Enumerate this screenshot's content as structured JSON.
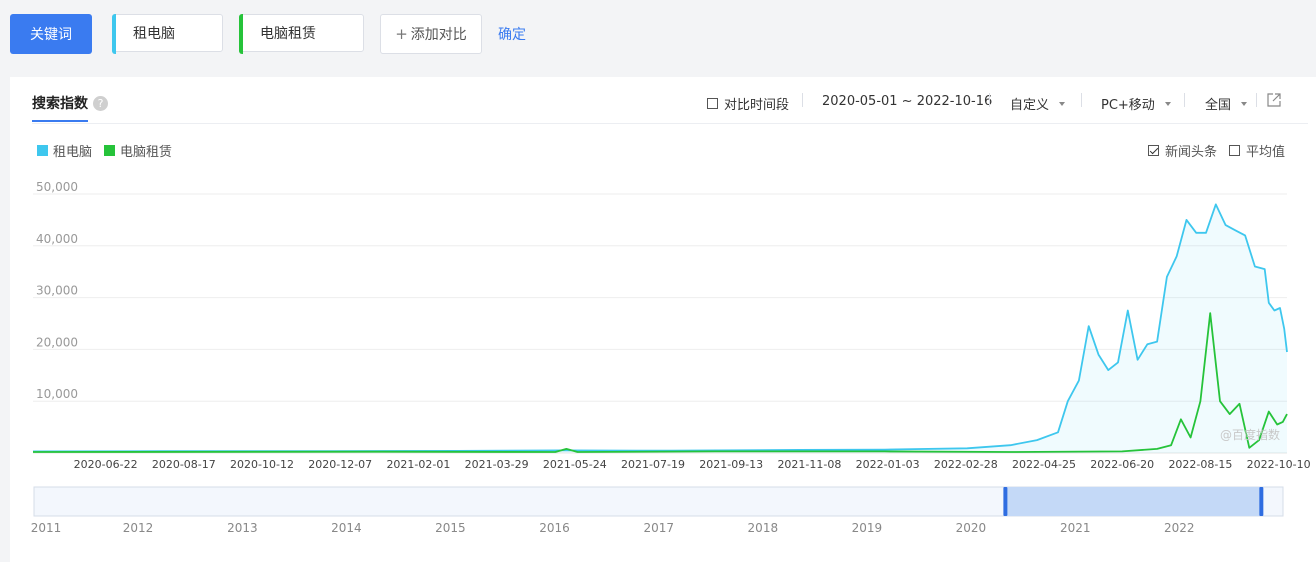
{
  "toolbar": {
    "keyword_button": "关键词",
    "keywords": [
      {
        "label": "租电脑",
        "color": "#3ec7ee"
      },
      {
        "label": "电脑租赁",
        "color": "#26c33a"
      }
    ],
    "add_compare": "添加对比",
    "confirm": "确定"
  },
  "panel": {
    "tab_label": "搜索指数",
    "help_glyph": "?",
    "compare_period": "对比时间段",
    "date_range": "2020-05-01 ~ 2022-10-16",
    "custom": "自定义",
    "device": "PC+移动",
    "region": "全国",
    "news_headlines": "新闻头条",
    "average": "平均值",
    "watermark": "@百度指数"
  },
  "chart_data": {
    "type": "line",
    "title": "",
    "xlabel": "",
    "ylabel": "",
    "ylim": [
      0,
      50000
    ],
    "yticks": [
      "10,000",
      "20,000",
      "30,000",
      "40,000",
      "50,000"
    ],
    "ytick_values": [
      10000,
      20000,
      30000,
      40000,
      50000
    ],
    "x_tick_labels": [
      "2020-06-22",
      "2020-08-17",
      "2020-10-12",
      "2020-12-07",
      "2021-02-01",
      "2021-03-29",
      "2021-05-24",
      "2021-07-19",
      "2021-09-13",
      "2021-11-08",
      "2022-01-03",
      "2022-02-28",
      "2022-04-25",
      "2022-06-20",
      "2022-08-15",
      "2022-10-10"
    ],
    "x_start": "2020-05-01",
    "x_end": "2022-10-16",
    "grid": true,
    "legend": "top-left",
    "series": [
      {
        "name": "租电脑",
        "color": "#3ec7ee",
        "area": true,
        "points": [
          [
            "2020-05-01",
            300
          ],
          [
            "2020-08-01",
            350
          ],
          [
            "2020-12-01",
            350
          ],
          [
            "2021-03-01",
            400
          ],
          [
            "2021-05-15",
            500
          ],
          [
            "2021-08-01",
            450
          ],
          [
            "2021-11-01",
            600
          ],
          [
            "2022-01-01",
            650
          ],
          [
            "2022-03-01",
            900
          ],
          [
            "2022-04-01",
            1500
          ],
          [
            "2022-04-20",
            2500
          ],
          [
            "2022-05-05",
            4000
          ],
          [
            "2022-05-12",
            10000
          ],
          [
            "2022-05-20",
            14000
          ],
          [
            "2022-05-27",
            24500
          ],
          [
            "2022-06-03",
            19000
          ],
          [
            "2022-06-10",
            16000
          ],
          [
            "2022-06-17",
            17500
          ],
          [
            "2022-06-24",
            27500
          ],
          [
            "2022-07-01",
            18000
          ],
          [
            "2022-07-08",
            21000
          ],
          [
            "2022-07-15",
            21500
          ],
          [
            "2022-07-22",
            34000
          ],
          [
            "2022-07-29",
            38000
          ],
          [
            "2022-08-05",
            45000
          ],
          [
            "2022-08-12",
            42500
          ],
          [
            "2022-08-19",
            42500
          ],
          [
            "2022-08-26",
            48000
          ],
          [
            "2022-09-02",
            44000
          ],
          [
            "2022-09-09",
            43000
          ],
          [
            "2022-09-16",
            42000
          ],
          [
            "2022-09-23",
            36000
          ],
          [
            "2022-09-30",
            35500
          ],
          [
            "2022-10-03",
            29000
          ],
          [
            "2022-10-07",
            27500
          ],
          [
            "2022-10-11",
            28000
          ],
          [
            "2022-10-14",
            24000
          ],
          [
            "2022-10-16",
            19500
          ]
        ]
      },
      {
        "name": "电脑租赁",
        "color": "#26c33a",
        "area": false,
        "points": [
          [
            "2020-05-01",
            200
          ],
          [
            "2021-01-01",
            250
          ],
          [
            "2021-05-10",
            200
          ],
          [
            "2021-05-18",
            800
          ],
          [
            "2021-05-26",
            200
          ],
          [
            "2021-09-01",
            300
          ],
          [
            "2022-01-01",
            300
          ],
          [
            "2022-04-01",
            200
          ],
          [
            "2022-06-20",
            300
          ],
          [
            "2022-07-15",
            800
          ],
          [
            "2022-07-25",
            1500
          ],
          [
            "2022-08-01",
            6500
          ],
          [
            "2022-08-08",
            3000
          ],
          [
            "2022-08-15",
            10000
          ],
          [
            "2022-08-22",
            27000
          ],
          [
            "2022-08-29",
            10000
          ],
          [
            "2022-09-05",
            7500
          ],
          [
            "2022-09-12",
            9500
          ],
          [
            "2022-09-19",
            1000
          ],
          [
            "2022-09-26",
            2500
          ],
          [
            "2022-10-03",
            8000
          ],
          [
            "2022-10-09",
            5500
          ],
          [
            "2022-10-13",
            6000
          ],
          [
            "2022-10-16",
            7500
          ]
        ]
      }
    ],
    "range_selector": {
      "years": [
        "2011",
        "2012",
        "2013",
        "2014",
        "2015",
        "2016",
        "2017",
        "2018",
        "2019",
        "2020",
        "2021",
        "2022"
      ],
      "selected_start": "2020-05-01",
      "selected_end": "2022-10-16"
    }
  }
}
